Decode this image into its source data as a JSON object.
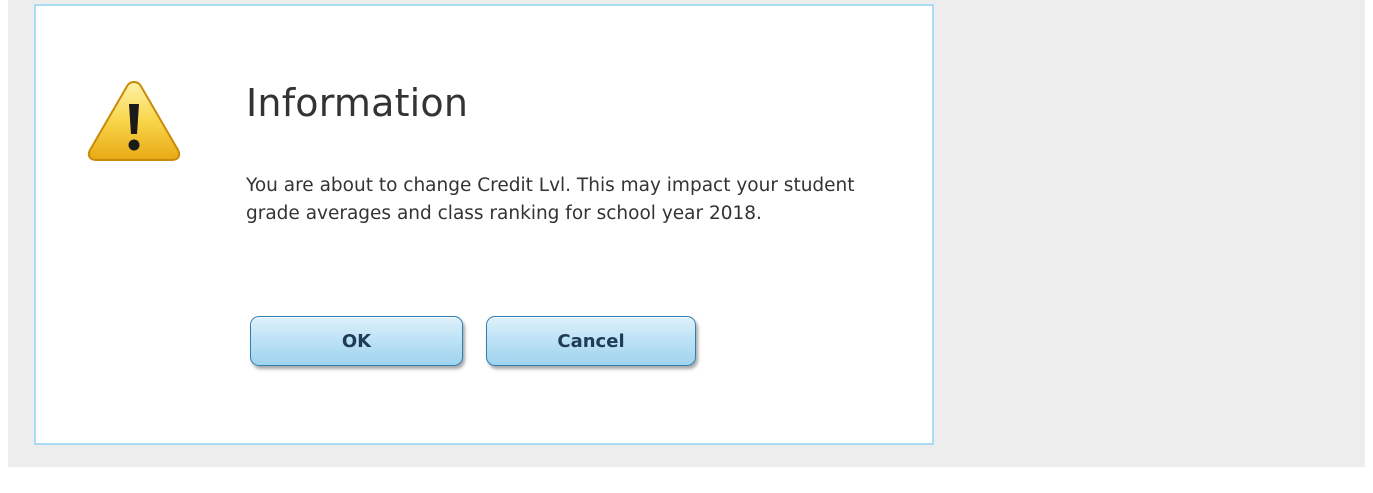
{
  "dialog": {
    "title": "Information",
    "icon": "warning-icon",
    "message": "You are about to change Credit Lvl. This may impact your student grade averages and class ranking for school year 2018.",
    "ok_label": "OK",
    "cancel_label": "Cancel"
  },
  "colors": {
    "dialog_border": "#a9dcf3",
    "backdrop": "#ededed",
    "button_border": "#2f7fb0",
    "warning_yellow": "#f6c21b"
  }
}
